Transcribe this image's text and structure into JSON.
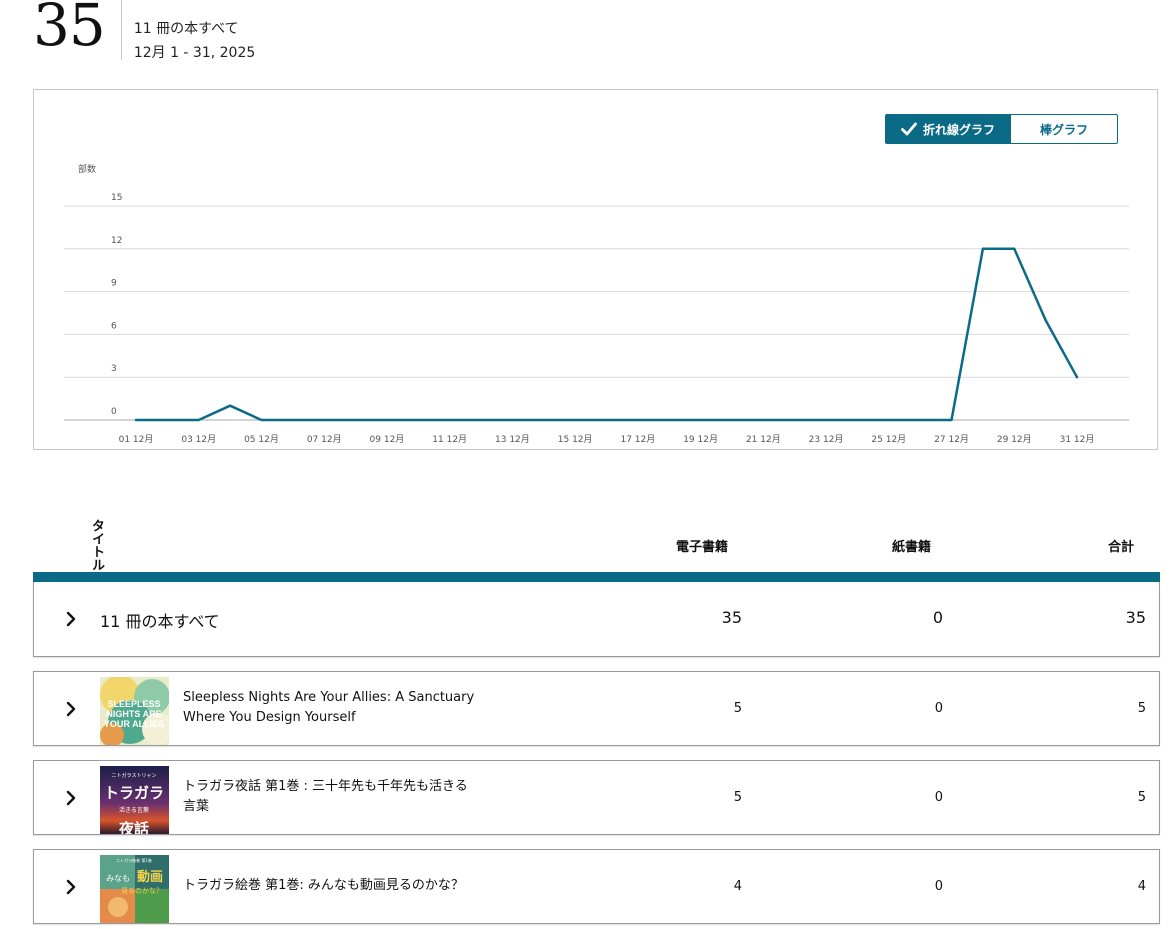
{
  "summary": {
    "total_units": "35",
    "books_label": "11 冊の本すべて",
    "date_range": "12月 1 - 31, 2025"
  },
  "chart_toggle": {
    "line_label": "折れ線グラフ",
    "bar_label": "棒グラフ",
    "selected": "line"
  },
  "chart_data": {
    "type": "line",
    "ylabel": "部数",
    "ylim": [
      0,
      15
    ],
    "yticks": [
      0,
      3,
      6,
      9,
      12,
      15
    ],
    "xlabels": [
      "01 12月",
      "03 12月",
      "05 12月",
      "07 12月",
      "09 12月",
      "11 12月",
      "13 12月",
      "15 12月",
      "17 12月",
      "19 12月",
      "21 12月",
      "23 12月",
      "25 12月",
      "27 12月",
      "29 12月",
      "31 12月"
    ],
    "x": [
      1,
      2,
      3,
      4,
      5,
      6,
      7,
      8,
      9,
      10,
      11,
      12,
      13,
      14,
      15,
      16,
      17,
      18,
      19,
      20,
      21,
      22,
      23,
      24,
      25,
      26,
      27,
      28,
      29,
      30,
      31
    ],
    "series": [
      {
        "values": [
          0,
          0,
          0,
          1,
          0,
          0,
          0,
          0,
          0,
          0,
          0,
          0,
          0,
          0,
          0,
          0,
          0,
          0,
          0,
          0,
          0,
          0,
          0,
          0,
          0,
          0,
          0,
          12,
          12,
          7,
          3
        ]
      }
    ],
    "color": "#0b6b86",
    "grid": true
  },
  "table": {
    "headers": {
      "title": "タイトル",
      "ebook": "電子書籍",
      "paper": "紙書籍",
      "total": "合計"
    },
    "total_row": {
      "label": "11 冊の本すべて",
      "ebook": "35",
      "paper": "0",
      "total": "35"
    },
    "rows": [
      {
        "title_line1": "Sleepless Nights Are Your Allies: A Sanctuary",
        "title_line2": "Where You Design Yourself",
        "ebook": "5",
        "paper": "0",
        "total": "5",
        "cover_text": "SLEEPLESS NIGHTS ARE YOUR ALLIES"
      },
      {
        "title_line1": "トラガラ夜話 第1巻 : 三十年先も千年先も活きる",
        "title_line2": "言葉",
        "ebook": "5",
        "paper": "0",
        "total": "5",
        "cover_text": "トラガラ 夜話"
      },
      {
        "title_line1": "トラガラ絵巻 第1巻: みんなも動画見るのかな？",
        "title_line2": "",
        "ebook": "4",
        "paper": "0",
        "total": "4",
        "cover_text": "みんなも 動画 見るのかな？"
      }
    ]
  }
}
